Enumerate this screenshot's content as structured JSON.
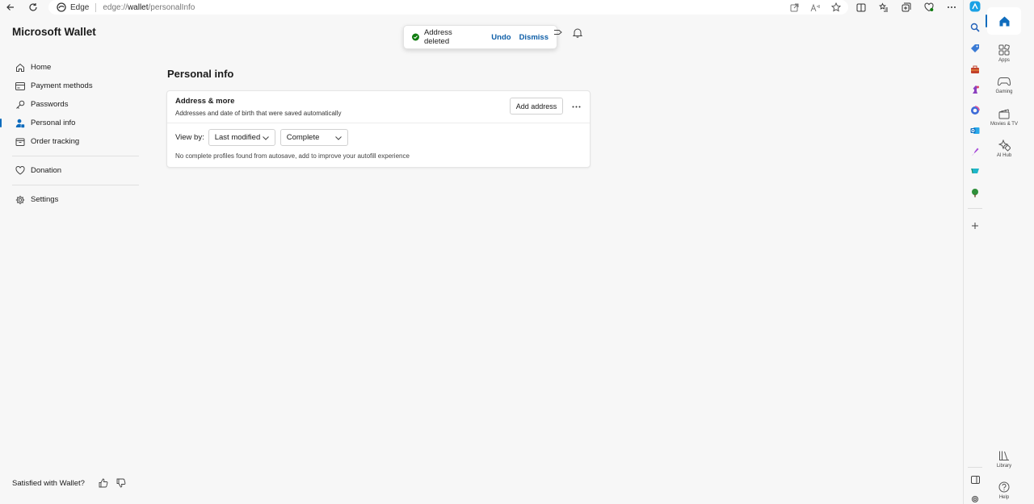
{
  "browser": {
    "site_name": "Edge",
    "url_prefix": "edge://",
    "url_host": "wallet",
    "url_path": "/personalInfo"
  },
  "wallet": {
    "title": "Microsoft Wallet",
    "nav": [
      {
        "label": "Home",
        "icon": "home-icon"
      },
      {
        "label": "Payment methods",
        "icon": "card-icon"
      },
      {
        "label": "Passwords",
        "icon": "key-icon"
      },
      {
        "label": "Personal info",
        "icon": "person-icon",
        "active": true
      },
      {
        "label": "Order tracking",
        "icon": "box-icon"
      },
      {
        "label": "Donation",
        "icon": "heart-icon"
      },
      {
        "label": "Settings",
        "icon": "gear-icon"
      }
    ],
    "feedback_label": "Satisfied with Wallet?"
  },
  "toast": {
    "message": "Address deleted",
    "undo_label": "Undo",
    "dismiss_label": "Dismiss"
  },
  "main": {
    "page_title": "Personal info",
    "card": {
      "title": "Address & more",
      "subtitle": "Addresses and date of birth that were saved automatically",
      "add_button_label": "Add address",
      "view_by_label": "View by:",
      "sort_selected": "Last modified",
      "filter_selected": "Complete",
      "empty_message": "No complete profiles found from autosave, add to improve your autofill experience"
    }
  },
  "sidebar_panel": {
    "items": [
      {
        "label": "Apps",
        "icon": "apps-icon"
      },
      {
        "label": "Gaming",
        "icon": "gamepad-icon"
      },
      {
        "label": "Movies & TV",
        "icon": "film-icon"
      },
      {
        "label": "AI Hub",
        "icon": "sparkle-icon"
      },
      {
        "label": "Library",
        "icon": "library-icon"
      },
      {
        "label": "Help",
        "icon": "help-icon"
      }
    ]
  },
  "colors": {
    "accent": "#0f6cbd",
    "toast_link": "#0f5fa8",
    "success": "#107c10"
  }
}
